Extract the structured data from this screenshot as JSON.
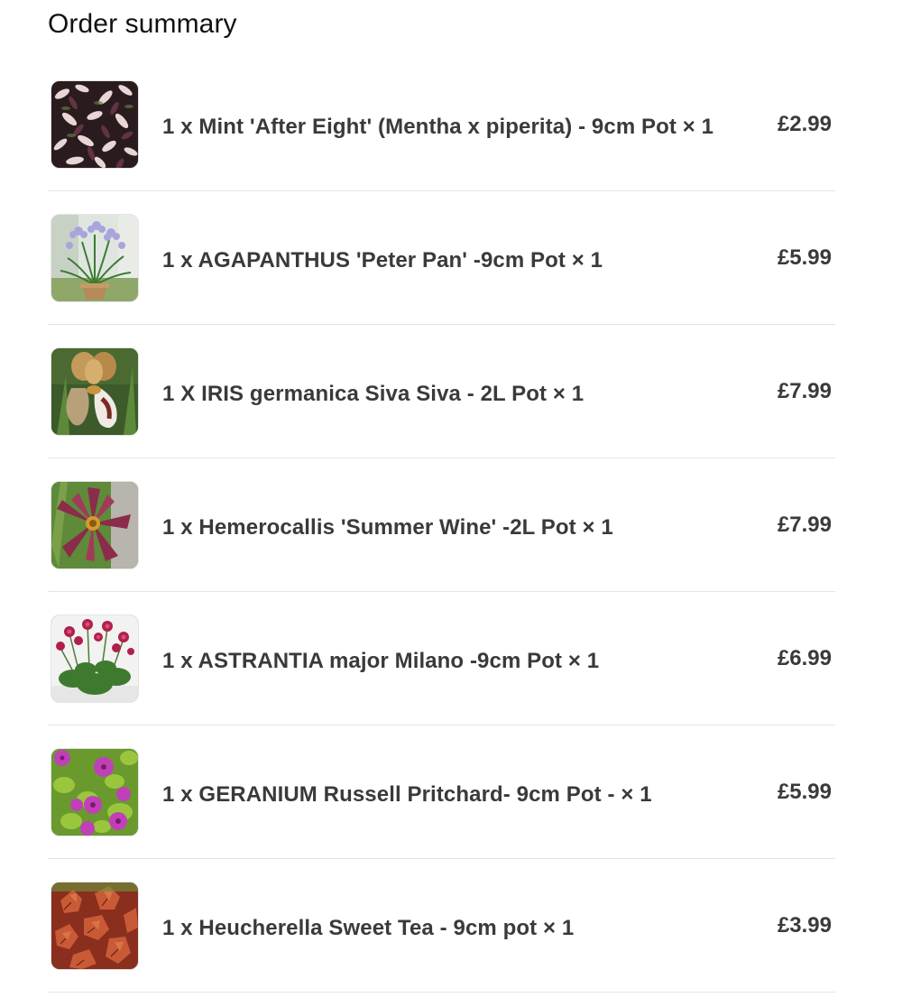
{
  "order_summary": {
    "title": "Order summary",
    "items": [
      {
        "description": "1 x Mint 'After Eight' (Mentha x piperita) - 9cm Pot × 1",
        "price": "£2.99",
        "image": "mint-plant-image"
      },
      {
        "description": "1 x AGAPANTHUS 'Peter Pan' -9cm Pot × 1",
        "price": "£5.99",
        "image": "agapanthus-plant-image"
      },
      {
        "description": "1 X IRIS germanica Siva Siva - 2L Pot × 1",
        "price": "£7.99",
        "image": "iris-plant-image"
      },
      {
        "description": "1 x Hemerocallis 'Summer Wine' -2L Pot × 1",
        "price": "£7.99",
        "image": "hemerocallis-plant-image"
      },
      {
        "description": "1 x ASTRANTIA major Milano -9cm Pot × 1",
        "price": "£6.99",
        "image": "astrantia-plant-image"
      },
      {
        "description": "1 x GERANIUM Russell Pritchard- 9cm Pot - × 1",
        "price": "£5.99",
        "image": "geranium-plant-image"
      },
      {
        "description": "1 x Heucherella Sweet Tea - 9cm pot × 1",
        "price": "£3.99",
        "image": "heucherella-plant-image"
      }
    ]
  },
  "colors": {
    "text_primary": "#3a3a3c",
    "divider": "#e4e4e6",
    "background": "#ffffff"
  }
}
